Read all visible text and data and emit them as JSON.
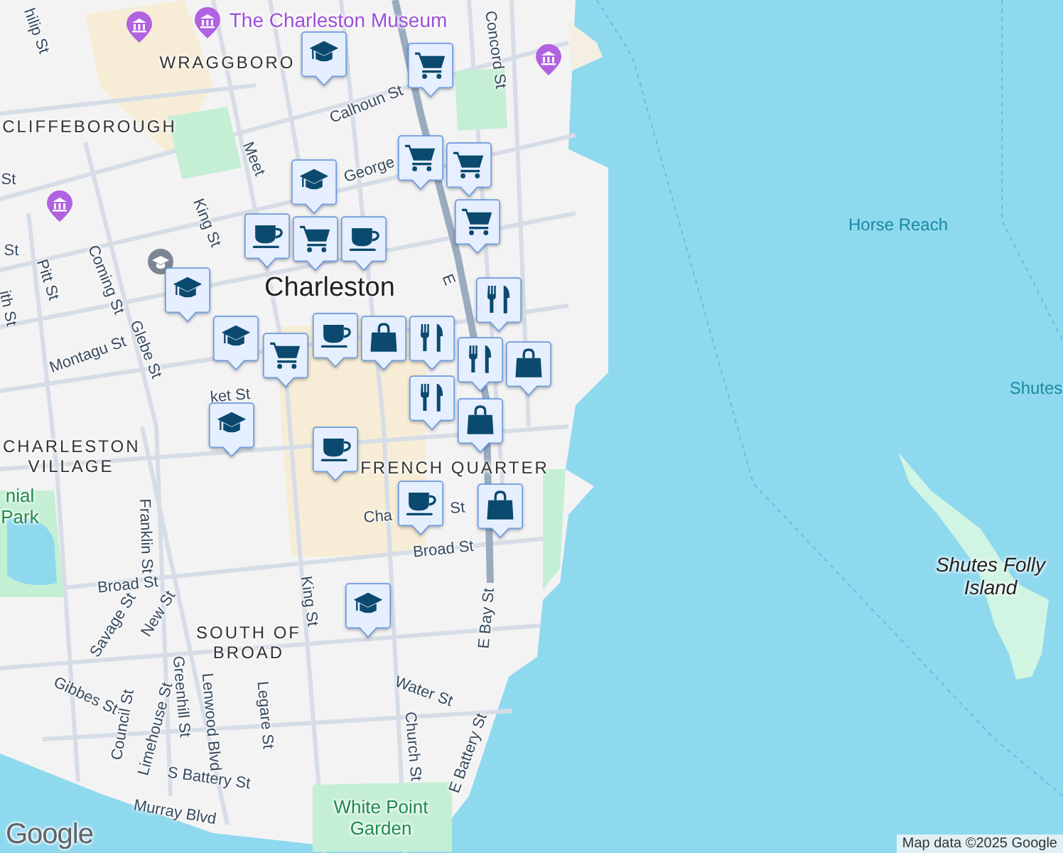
{
  "labels": [
    {
      "kind": "street",
      "text": "hilip St"
    },
    {
      "kind": "poi",
      "text": "The Charleston Museum"
    },
    {
      "kind": "street",
      "text": "Concord St"
    },
    {
      "kind": "district",
      "text": "WRAGGBORO"
    },
    {
      "kind": "street",
      "text": "Calhoun St"
    },
    {
      "kind": "district",
      "text": "CLIFFEBOROUGH"
    },
    {
      "kind": "street",
      "text": "Meet"
    },
    {
      "kind": "street",
      "text": "George"
    },
    {
      "kind": "street",
      "text": "St"
    },
    {
      "kind": "street",
      "text": "King St"
    },
    {
      "kind": "street",
      "text": "St"
    },
    {
      "kind": "street",
      "text": "Coming St"
    },
    {
      "kind": "street",
      "text": "Pitt St"
    },
    {
      "kind": "street",
      "text": "ith St"
    },
    {
      "kind": "city",
      "text": "Charleston"
    },
    {
      "kind": "street",
      "text": "E"
    },
    {
      "kind": "street",
      "text": "Glebe St"
    },
    {
      "kind": "street",
      "text": "Montagu St"
    },
    {
      "kind": "street",
      "text": "ket St"
    },
    {
      "kind": "district",
      "text": "CHARLESTON VILLAGE"
    },
    {
      "kind": "district",
      "text": "FRENCH QUARTER"
    },
    {
      "kind": "park",
      "text": "nial Park"
    },
    {
      "kind": "street",
      "text": "Cha"
    },
    {
      "kind": "street",
      "text": "St"
    },
    {
      "kind": "street",
      "text": "Broad St"
    },
    {
      "kind": "street",
      "text": "Franklin St"
    },
    {
      "kind": "street",
      "text": "Broad St"
    },
    {
      "kind": "street",
      "text": "Savage St"
    },
    {
      "kind": "street",
      "text": "New St"
    },
    {
      "kind": "street",
      "text": "King St"
    },
    {
      "kind": "street",
      "text": "E Bay St"
    },
    {
      "kind": "district",
      "text": "SOUTH OF BROAD"
    },
    {
      "kind": "street",
      "text": "Water St"
    },
    {
      "kind": "street",
      "text": "Gibbes St"
    },
    {
      "kind": "street",
      "text": "Council St"
    },
    {
      "kind": "street",
      "text": "Limehouse St"
    },
    {
      "kind": "street",
      "text": "Greenhill St"
    },
    {
      "kind": "street",
      "text": "Lenwood Blvd"
    },
    {
      "kind": "street",
      "text": "Legare St"
    },
    {
      "kind": "street",
      "text": "Church St"
    },
    {
      "kind": "street",
      "text": "S Battery St"
    },
    {
      "kind": "street",
      "text": "E Battery St"
    },
    {
      "kind": "street",
      "text": "Murray Blvd"
    },
    {
      "kind": "park",
      "text": "White Point Garden"
    },
    {
      "kind": "water",
      "text": "Horse Reach"
    },
    {
      "kind": "water",
      "text": "Shutes"
    },
    {
      "kind": "island",
      "text": "Shutes Folly Island"
    }
  ],
  "pins": [
    {
      "kind": "school"
    },
    {
      "kind": "grocery"
    },
    {
      "kind": "grocery"
    },
    {
      "kind": "grocery"
    },
    {
      "kind": "grocery"
    },
    {
      "kind": "cafe"
    },
    {
      "kind": "school"
    },
    {
      "kind": "grocery"
    },
    {
      "kind": "cafe"
    },
    {
      "kind": "school"
    },
    {
      "kind": "school"
    },
    {
      "kind": "grocery"
    },
    {
      "kind": "cafe"
    },
    {
      "kind": "restaurant"
    },
    {
      "kind": "shop"
    },
    {
      "kind": "restaurant"
    },
    {
      "kind": "restaurant"
    },
    {
      "kind": "restaurant"
    },
    {
      "kind": "shop"
    },
    {
      "kind": "school"
    },
    {
      "kind": "cafe"
    },
    {
      "kind": "shop"
    },
    {
      "kind": "cafe"
    },
    {
      "kind": "shop"
    },
    {
      "kind": "school"
    }
  ],
  "attribution": "Map data ©2025 Google",
  "logo": "Google"
}
